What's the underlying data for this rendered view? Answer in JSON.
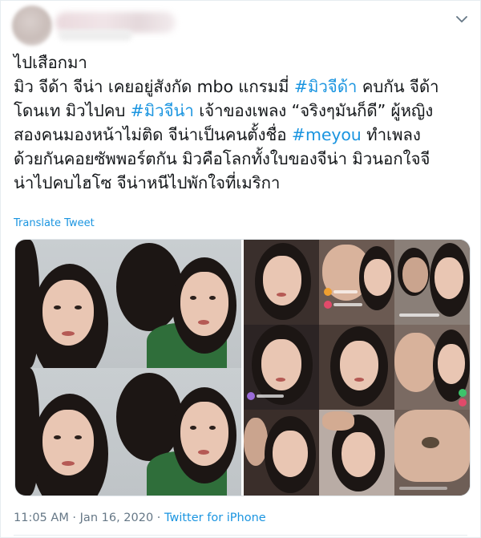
{
  "tweet": {
    "lines": [
      [
        {
          "t": "ไปเสือกมา"
        }
      ],
      [
        {
          "t": "มิว จีด้า จีน่า เคยอยู่สังกัด mbo แกรมมี่ "
        },
        {
          "t": "#มิวจีด้า",
          "tag": true
        },
        {
          "t": " คบกัน จีด้า"
        }
      ],
      [
        {
          "t": "โดนเท มิวไปคบ "
        },
        {
          "t": "#มิวจีน่า",
          "tag": true
        },
        {
          "t": " เจ้าของเพลง “จริงๆมันก็ดี” ผู้หญิง"
        }
      ],
      [
        {
          "t": "สองคนมองหน้าไม่ติด จีน่าเป็นคนตั้งชื่อ "
        },
        {
          "t": "#meyou",
          "tag": true
        },
        {
          "t": " ทำเพลง"
        }
      ],
      [
        {
          "t": "ด้วยกันคอยซัพพอร์ตกัน มิวคือโลกทั้งใบของจีน่า มิวนอกใจจี"
        }
      ],
      [
        {
          "t": "น่าไปคบไฮโซ จีน่าหนีไปพักใจที่เมริกา"
        }
      ]
    ],
    "translate_label": "Translate Tweet",
    "timestamp": "11:05 AM · Jan 16, 2020 · ",
    "client": "Twitter for iPhone"
  },
  "icons": {
    "menu": "chevron-down-icon"
  },
  "colors": {
    "link": "#1b95e0",
    "text": "#14171a",
    "muted": "#657786",
    "border": "#e6ecf0"
  }
}
